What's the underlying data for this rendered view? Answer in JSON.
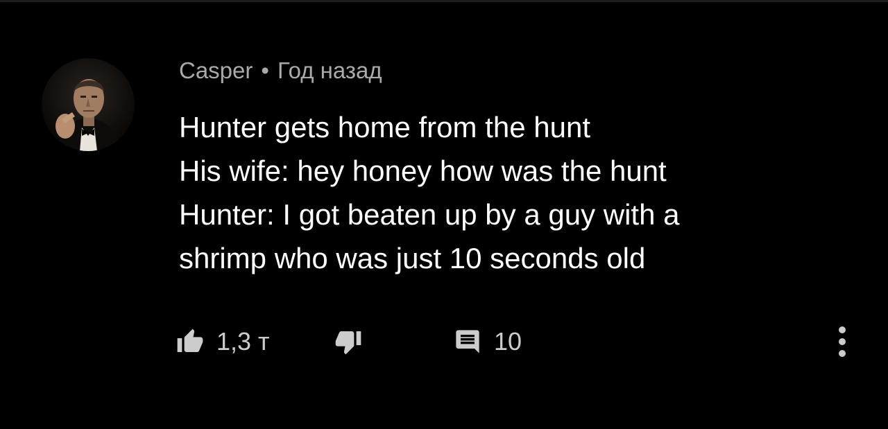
{
  "comment": {
    "author": "Casper",
    "separator": "•",
    "time_ago": "Год назад",
    "lines": [
      "Hunter gets home from the hunt",
      "His wife: hey honey how was the hunt",
      "Hunter: I got beaten up by a guy with a",
      "shrimp who was just 10 seconds old"
    ]
  },
  "actions": {
    "like_count": "1,3 т",
    "reply_count": "10",
    "like_icon": "thumbs-up-icon",
    "dislike_icon": "thumbs-down-icon",
    "reply_icon": "comment-icon",
    "more_icon": "more-vertical-icon"
  },
  "colors": {
    "background": "#000000",
    "text": "#ffffff",
    "meta": "#aaaaaa",
    "icon": "#cccccc"
  }
}
